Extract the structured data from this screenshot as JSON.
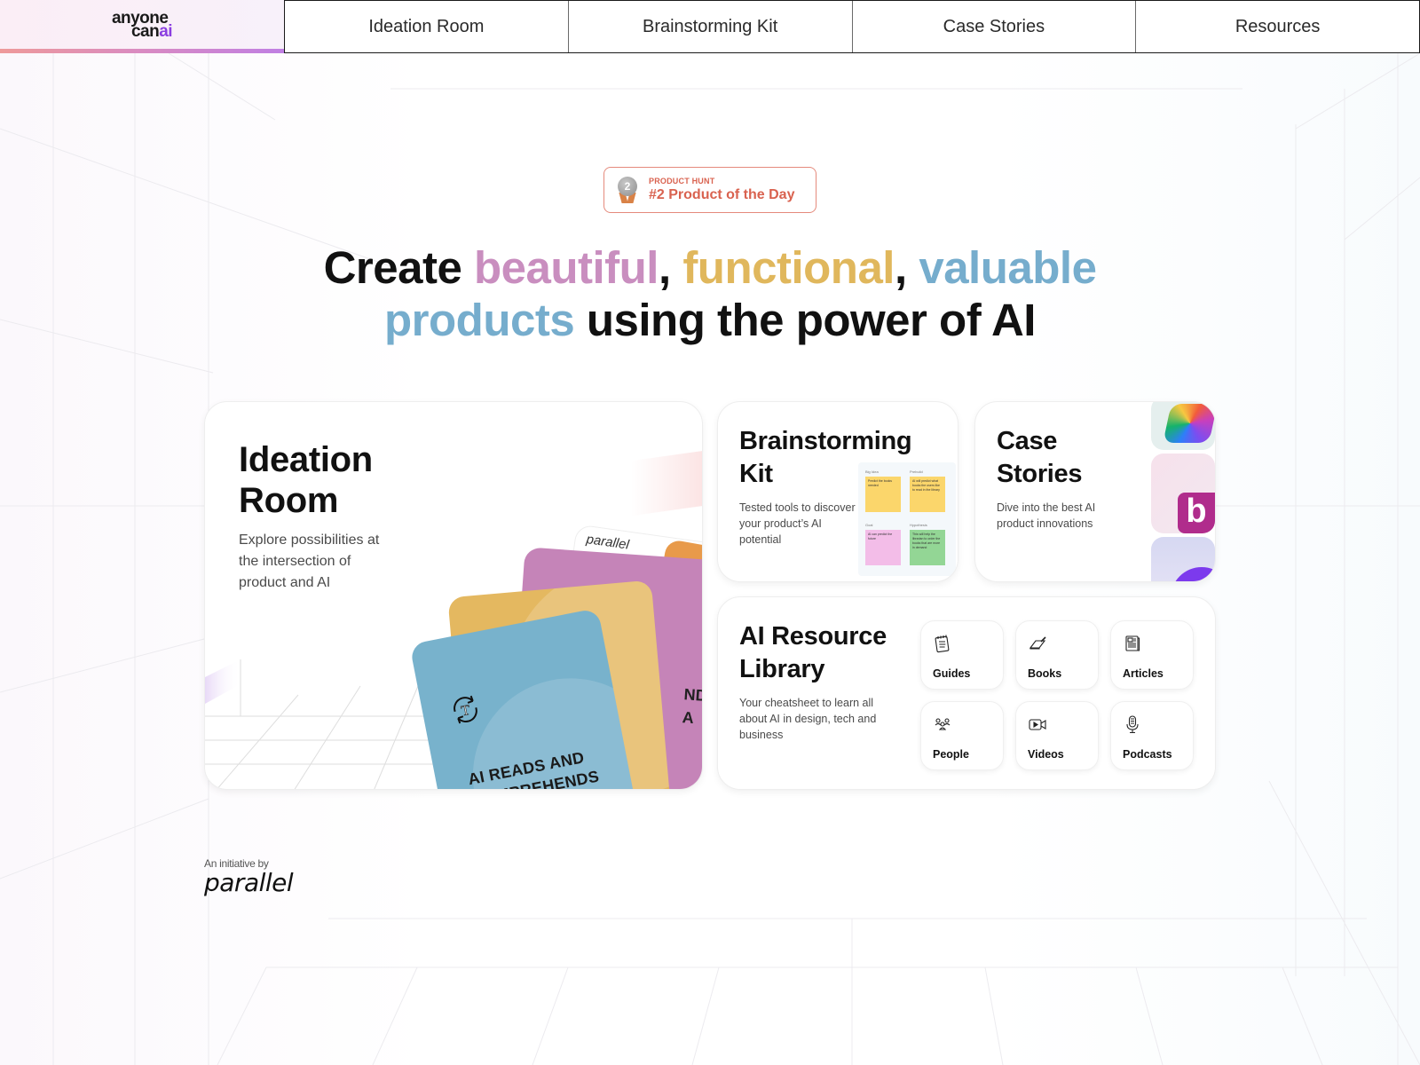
{
  "logo": {
    "line1": "anyone",
    "line2_prefix": "can",
    "line2_accent": "ai"
  },
  "nav": {
    "links": [
      "Ideation Room",
      "Brainstorming Kit",
      "Case Stories",
      "Resources"
    ]
  },
  "badge": {
    "icon": "medal-icon",
    "medal_number": "2",
    "kicker": "PRODUCT HUNT",
    "title": "#2 Product of the Day"
  },
  "headline": {
    "part1": "Create ",
    "word1": "beautiful",
    "sep1": ", ",
    "word2": "functional",
    "sep2": ", ",
    "word3": "valuable",
    "word4": "products",
    "part2": " using the power of AI",
    "colors": {
      "word1": "#c98ebf",
      "word2": "#e0b75c",
      "word3": "#76adcd",
      "word4": "#76adcd"
    }
  },
  "cards": {
    "ideation": {
      "title_line1": "Ideation",
      "title_line2": "Room",
      "description": "Explore possibilities at the intersection of product and AI",
      "deck": {
        "back_card_brand": "parallel",
        "front_card_text_line1": "AI READS AND",
        "front_card_text_line2": "COMPREHENDS",
        "partial_text_line1": "ND",
        "partial_text_line2": "A"
      }
    },
    "brainstorming": {
      "title_line1": "Brainstorming",
      "title_line2": "Kit",
      "description": "Tested tools to discover your product’s AI potential",
      "board": {
        "labels": [
          "Big Idea",
          "Prebuild",
          "Goal",
          "Hypothesis"
        ],
        "notes": [
          "Predict the books needed",
          "AI will predict what books the users like to read in the library",
          "AI can predict the future",
          "This will help the librarian to order the books that are more in demand"
        ]
      }
    },
    "case_stories": {
      "title_line1": "Case",
      "title_line2": "Stories",
      "description": "Dive into the best AI product innovations",
      "tiles": [
        "copilot-logo",
        "b-logo",
        "purple-logo"
      ]
    },
    "library": {
      "title_line1": "AI Resource",
      "title_line2": "Library",
      "description": "Your cheatsheet to learn all about AI in design, tech and business",
      "items": [
        {
          "label": "Guides",
          "icon": "notepad-icon"
        },
        {
          "label": "Books",
          "icon": "book-icon"
        },
        {
          "label": "Articles",
          "icon": "newspaper-icon"
        },
        {
          "label": "People",
          "icon": "people-icon"
        },
        {
          "label": "Videos",
          "icon": "video-icon"
        },
        {
          "label": "Podcasts",
          "icon": "microphone-icon"
        }
      ]
    }
  },
  "footer": {
    "initiative_label": "An initiative by",
    "brand": "parallel"
  }
}
